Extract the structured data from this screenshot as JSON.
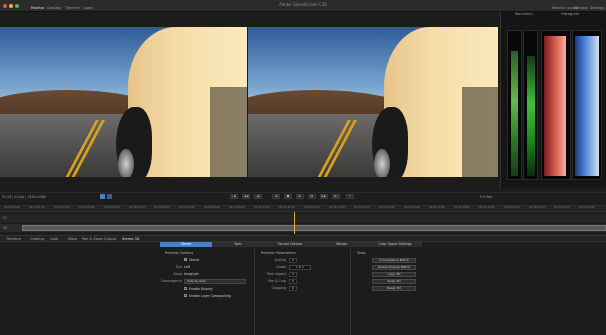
{
  "window": {
    "title": "Adobe SpeedGrade CS6"
  },
  "menu": [
    {
      "label": "Monitor"
    },
    {
      "label": "Desktop"
    },
    {
      "label": "Timeline"
    },
    {
      "label": "Looks"
    }
  ],
  "menu_right": [
    {
      "label": "Monitor Layout"
    },
    {
      "label": "Window"
    },
    {
      "label": "Settings"
    }
  ],
  "scopes": {
    "title": "Waveform",
    "title2": "Histogram"
  },
  "infobar": {
    "left": "01:24 | 24 fps | 1920×1080",
    "right": "Full Res"
  },
  "ruler": {
    "ticks": [
      "00:00:00:00",
      "00:00:01:00",
      "00:00:02:00",
      "00:00:03:00",
      "00:00:04:00",
      "00:00:05:00",
      "00:00:06:00",
      "00:00:07:00",
      "00:00:08:00",
      "00:00:09:00",
      "00:00:10:00",
      "00:00:11:00",
      "00:00:12:00",
      "00:00:13:00",
      "00:00:14:00",
      "00:00:15:00",
      "00:00:16:00",
      "00:00:17:00",
      "00:00:18:00",
      "00:00:19:00",
      "00:00:20:00",
      "00:00:21:00",
      "00:00:22:00",
      "00:00:23:00"
    ]
  },
  "tracks": {
    "track1_label": "V1",
    "track2_label": "V2"
  },
  "panel_tabs": [
    {
      "label": "Timeline"
    },
    {
      "label": "Grading"
    },
    {
      "label": "Look"
    },
    {
      "label": "Mask"
    },
    {
      "label": "Pan & Zoom"
    },
    {
      "label": "Output"
    },
    {
      "label": "Stereo 3D"
    }
  ],
  "subtabs": [
    {
      "label": "Stereo"
    },
    {
      "label": "Tools"
    },
    {
      "label": "Format Options"
    },
    {
      "label": "Render"
    },
    {
      "label": "Color Space Settings"
    }
  ],
  "stereo_options": {
    "heading": "Preview Options",
    "stereo_label": "Stereo",
    "eye_label": "Eye",
    "eye_value": "Left",
    "swap_label": "Swap",
    "swap_value": "Anaglyph",
    "display_label": "Convergence",
    "display_value": "Side-by-Side",
    "enable_display": "Enable Display",
    "enable_comp": "Enable Layer Compositing"
  },
  "preview_params": {
    "heading": "Preview Parameters",
    "scaling_label": "Scaling",
    "scaling_value": "0",
    "mode_label": "Grade",
    "mode_value": "L  R  C",
    "pixel_label": "Pixel Aspect",
    "pixel_value": "1",
    "offset_label": "Pan & Crop",
    "offset_value": "0",
    "crop_label": "Cropping",
    "crop_value": "0"
  },
  "tools": {
    "heading": "Tools",
    "buttons": [
      "Convergence Match",
      "Global Change Match",
      "Copy 3D",
      "Swap 3D",
      "Reset 3D"
    ]
  },
  "colors": {
    "accent": "#4a7fc1",
    "playhead": "#e8a33a"
  }
}
